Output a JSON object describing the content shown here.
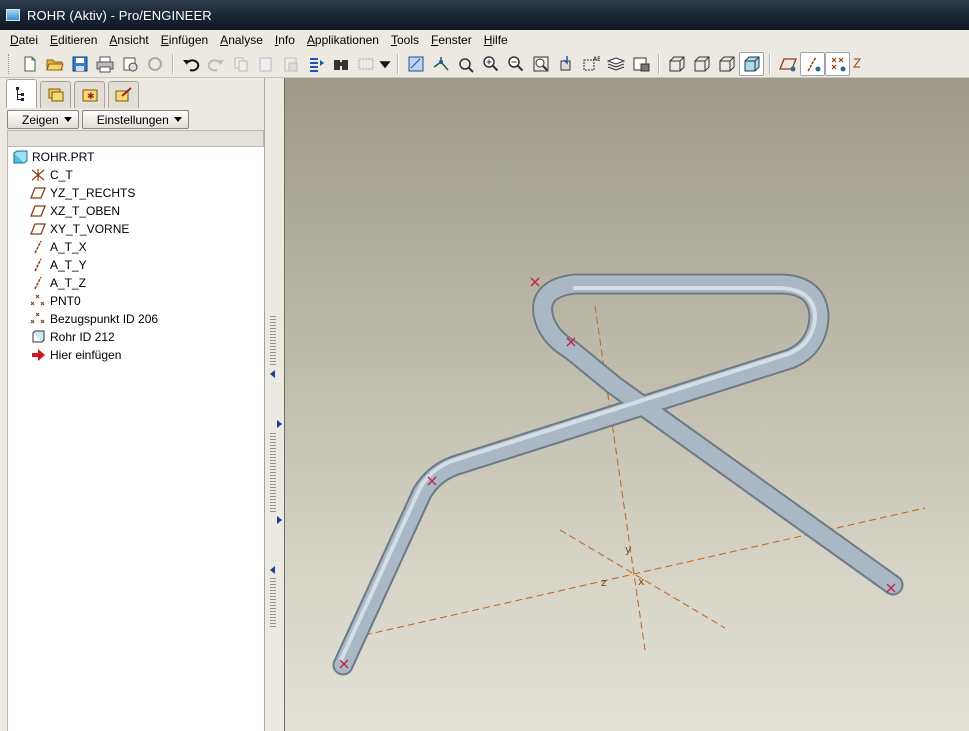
{
  "window": {
    "title": "ROHR (Aktiv) - Pro/ENGINEER"
  },
  "menu": [
    {
      "label": "Datei"
    },
    {
      "label": "Editieren"
    },
    {
      "label": "Ansicht"
    },
    {
      "label": "Einfügen"
    },
    {
      "label": "Analyse"
    },
    {
      "label": "Info"
    },
    {
      "label": "Applikationen"
    },
    {
      "label": "Tools"
    },
    {
      "label": "Fenster"
    },
    {
      "label": "Hilfe"
    }
  ],
  "toolbar": {
    "icons": [
      "new-file-icon",
      "open-folder-icon",
      "save-icon",
      "print-icon",
      "send-mail-icon",
      "share-icon",
      "undo-icon",
      "redo-icon",
      "copy-icon",
      "paste-icon",
      "paste-special-icon",
      "regenerate-icon",
      "find-icon",
      "select-box-icon",
      "dropdown-icon",
      "repaint-icon",
      "spin-center-icon",
      "orient-mode-icon",
      "zoom-in-icon",
      "zoom-out-icon",
      "refit-icon",
      "reorient-icon",
      "saved-views-icon",
      "layers-icon",
      "view-manager-icon",
      "wireframe-icon",
      "hidden-line-icon",
      "no-hidden-icon",
      "shading-icon",
      "datum-planes-icon",
      "datum-axes-icon",
      "datum-points-icon",
      "coord-sys-icon"
    ]
  },
  "panel": {
    "tabs": [
      "model-tree-tab",
      "folder-browser-tab",
      "favorites-tab",
      "connections-tab"
    ],
    "show_button": "Zeigen",
    "settings_button": "Einstellungen",
    "tree": [
      {
        "label": "ROHR.PRT",
        "icon": "part-icon",
        "indent": 0
      },
      {
        "label": "C_T",
        "icon": "coordinate-system-icon",
        "indent": 1
      },
      {
        "label": "YZ_T_RECHTS",
        "icon": "datum-plane-icon",
        "indent": 1
      },
      {
        "label": "XZ_T_OBEN",
        "icon": "datum-plane-icon",
        "indent": 1
      },
      {
        "label": "XY_T_VORNE",
        "icon": "datum-plane-icon",
        "indent": 1
      },
      {
        "label": "A_T_X",
        "icon": "datum-axis-icon",
        "indent": 1
      },
      {
        "label": "A_T_Y",
        "icon": "datum-axis-icon",
        "indent": 1
      },
      {
        "label": "A_T_Z",
        "icon": "datum-axis-icon",
        "indent": 1
      },
      {
        "label": "PNT0",
        "icon": "datum-point-icon",
        "indent": 1
      },
      {
        "label": "Bezugspunkt ID 206",
        "icon": "datum-point-icon",
        "indent": 1
      },
      {
        "label": "Rohr ID 212",
        "icon": "pipe-feature-icon",
        "indent": 1
      },
      {
        "label": "Hier einfügen",
        "icon": "insert-here-icon",
        "indent": 1
      }
    ]
  },
  "viewport": {
    "axis_labels": {
      "y": "y",
      "z": "z",
      "x": "x"
    },
    "colors": {
      "pipe": "#a9b8c4",
      "datum": "#c2651a",
      "point": "#c0203a"
    }
  }
}
